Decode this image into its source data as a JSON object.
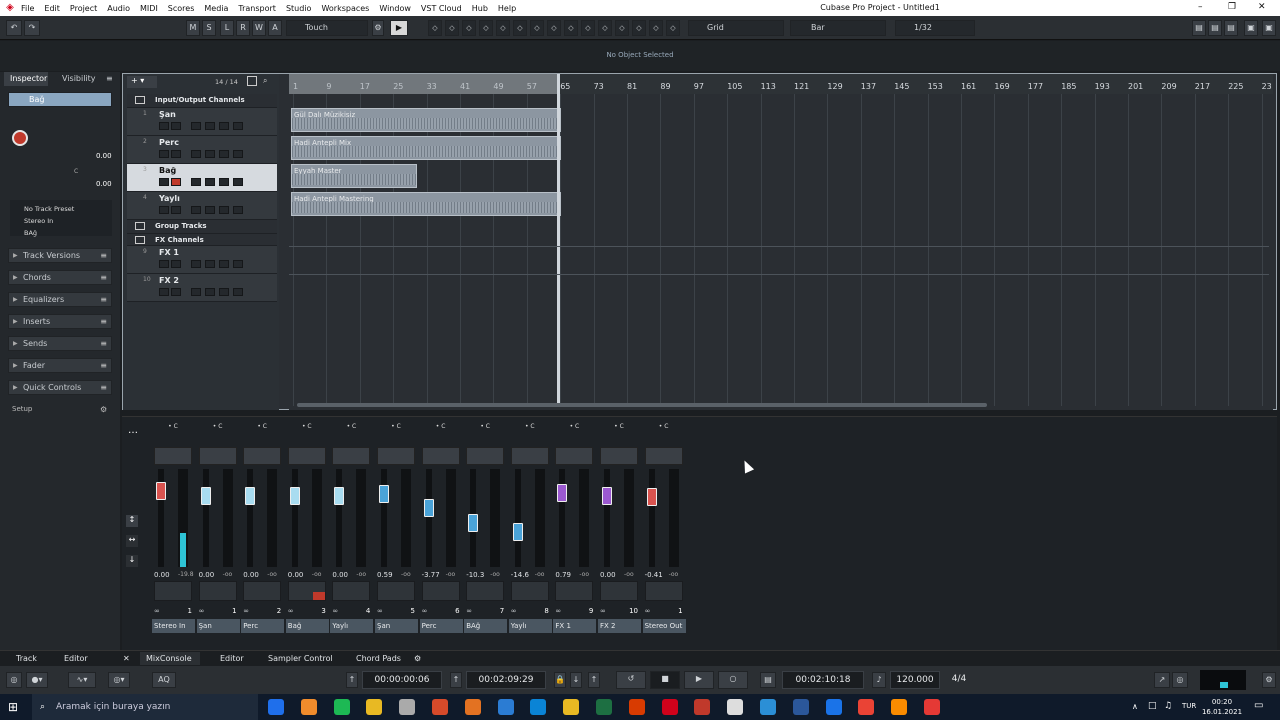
{
  "app": {
    "window_title": "Cubase Pro Project - Untitled1",
    "menu": [
      "File",
      "Edit",
      "Project",
      "Audio",
      "MIDI",
      "Scores",
      "Media",
      "Transport",
      "Studio",
      "Workspaces",
      "Window",
      "VST Cloud",
      "Hub",
      "Help"
    ]
  },
  "toolbar": {
    "mode_buttons": [
      "M",
      "S",
      "L",
      "R",
      "W",
      "A"
    ],
    "automation_mode": "Touch",
    "snap_type": "Grid",
    "grid_type": "Bar",
    "quantize": "1/32"
  },
  "info_line": {
    "status": "No Object Selected"
  },
  "inspector": {
    "tabs": [
      "Inspector",
      "Visibility"
    ],
    "track_name": "Bağ",
    "volume": "0.00",
    "pan": "C",
    "delay": "0.00",
    "preset": "No Track Preset",
    "output": "Stereo In",
    "channel": "BAğ",
    "sections": [
      "Track Versions",
      "Chords",
      "Equalizers",
      "Inserts",
      "Sends",
      "Fader",
      "Quick Controls"
    ],
    "setup_label": "Setup"
  },
  "project": {
    "track_count": "14 / 14",
    "tracks": [
      {
        "name": "Input/Output Channels",
        "type": "folder",
        "num": ""
      },
      {
        "name": "Şan",
        "type": "audio",
        "num": "1"
      },
      {
        "name": "Perc",
        "type": "audio",
        "num": "2"
      },
      {
        "name": "Bağ",
        "type": "audio",
        "num": "3",
        "selected": true
      },
      {
        "name": "Yaylı",
        "type": "audio",
        "num": "4"
      },
      {
        "name": "Group Tracks",
        "type": "folder",
        "num": ""
      },
      {
        "name": "FX Channels",
        "type": "folder",
        "num": ""
      },
      {
        "name": "FX 1",
        "type": "fx",
        "num": "9"
      },
      {
        "name": "FX 2",
        "type": "fx",
        "num": "10"
      }
    ],
    "ruler": [
      "1",
      "9",
      "17",
      "25",
      "33",
      "41",
      "49",
      "57",
      "65",
      "73",
      "81",
      "89",
      "97",
      "105",
      "113",
      "121",
      "129",
      "137",
      "145",
      "153",
      "161",
      "169",
      "177",
      "185",
      "193",
      "201",
      "209",
      "217",
      "225",
      "23"
    ],
    "clips": [
      {
        "name": "Gül Dalı Müzikisiz"
      },
      {
        "name": "Hadi Antepli Mix"
      },
      {
        "name": "Eyyah Master"
      },
      {
        "name": "Hadi Antepli Mastering"
      }
    ]
  },
  "mixer": {
    "channels": [
      {
        "name": "Stereo In",
        "value": "0.00",
        "peak": "-19.8",
        "num": "1",
        "color": "#d9534f",
        "fader_level": 0.78
      },
      {
        "name": "Şan",
        "value": "0.00",
        "peak": "-oo",
        "num": "1",
        "color": "#a8dcf0",
        "fader_level": 0.72
      },
      {
        "name": "Perc",
        "value": "0.00",
        "peak": "-oo",
        "num": "2",
        "color": "#a8dcf0",
        "fader_level": 0.72
      },
      {
        "name": "Bağ",
        "value": "0.00",
        "peak": "-oo",
        "num": "3",
        "color": "#a8dcf0",
        "fader_level": 0.72
      },
      {
        "name": "Yaylı",
        "value": "0.00",
        "peak": "-oo",
        "num": "4",
        "color": "#a8dcf0",
        "fader_level": 0.72
      },
      {
        "name": "Şan",
        "value": "0.59",
        "peak": "-oo",
        "num": "5",
        "color": "#4aa3d8",
        "fader_level": 0.74
      },
      {
        "name": "Perc",
        "value": "-3.77",
        "peak": "-oo",
        "num": "6",
        "color": "#4aa3d8",
        "fader_level": 0.6
      },
      {
        "name": "BAğ",
        "value": "-10.3",
        "peak": "-oo",
        "num": "7",
        "color": "#4aa3d8",
        "fader_level": 0.45
      },
      {
        "name": "Yaylı",
        "value": "-14.6",
        "peak": "-oo",
        "num": "8",
        "color": "#4aa3d8",
        "fader_level": 0.36
      },
      {
        "name": "FX 1",
        "value": "0.79",
        "peak": "-oo",
        "num": "9",
        "color": "#9b59d0",
        "fader_level": 0.76
      },
      {
        "name": "FX 2",
        "value": "0.00",
        "peak": "-oo",
        "num": "10",
        "color": "#9b59d0",
        "fader_level": 0.72
      },
      {
        "name": "Stereo Out",
        "value": "-0.41",
        "peak": "-oo",
        "num": "1",
        "color": "#d9534f",
        "fader_level": 0.71
      }
    ]
  },
  "lower_tabs": [
    "Track",
    "Editor",
    "MixConsole",
    "Editor",
    "Sampler Control",
    "Chord Pads"
  ],
  "transport": {
    "left_locator": "00:00:00:06",
    "right_locator": "00:02:09:29",
    "position": "00:02:10:18",
    "tempo": "120.000",
    "signature": "4/4"
  },
  "taskbar": {
    "search_placeholder": "Aramak için buraya yazın",
    "lang": "TUR",
    "time": "00:20",
    "date": "16.01.2021"
  }
}
